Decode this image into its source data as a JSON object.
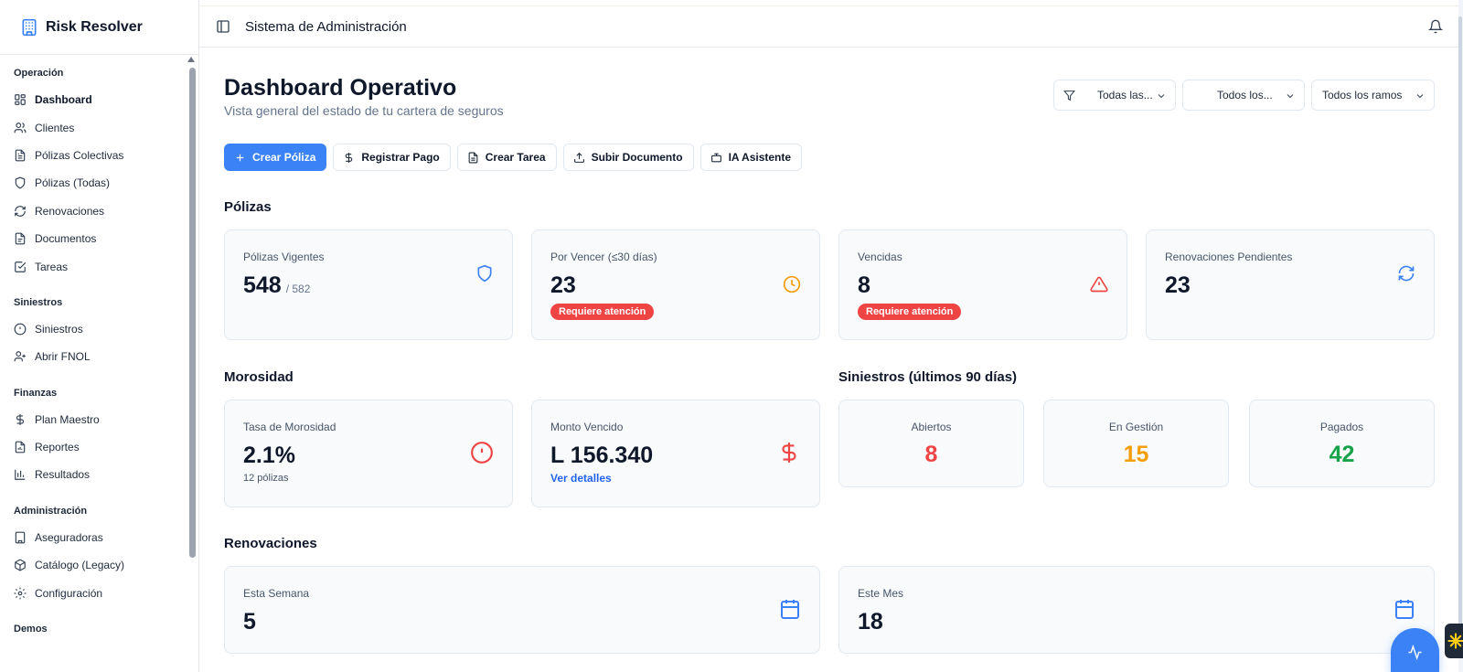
{
  "app": {
    "name": "Risk Resolver",
    "header_title": "Sistema de Administración"
  },
  "sidebar": {
    "sections": [
      {
        "title": "Operación",
        "items": [
          {
            "label": "Dashboard",
            "icon": "layout-dashboard-icon",
            "active": true
          },
          {
            "label": "Clientes",
            "icon": "users-icon"
          },
          {
            "label": "Pólizas Colectivas",
            "icon": "file-text-icon"
          },
          {
            "label": "Pólizas (Todas)",
            "icon": "shield-icon"
          },
          {
            "label": "Renovaciones",
            "icon": "refresh-icon"
          },
          {
            "label": "Documentos",
            "icon": "file-icon"
          },
          {
            "label": "Tareas",
            "icon": "check-square-icon"
          }
        ]
      },
      {
        "title": "Siniestros",
        "items": [
          {
            "label": "Siniestros",
            "icon": "alert-circle-icon"
          },
          {
            "label": "Abrir FNOL",
            "icon": "user-plus-icon"
          }
        ]
      },
      {
        "title": "Finanzas",
        "items": [
          {
            "label": "Plan Maestro",
            "icon": "dollar-icon"
          },
          {
            "label": "Reportes",
            "icon": "report-icon"
          },
          {
            "label": "Resultados",
            "icon": "bar-chart-icon"
          }
        ]
      },
      {
        "title": "Administración",
        "items": [
          {
            "label": "Aseguradoras",
            "icon": "building-icon"
          },
          {
            "label": "Catálogo (Legacy)",
            "icon": "package-icon"
          },
          {
            "label": "Configuración",
            "icon": "gear-icon"
          }
        ]
      },
      {
        "title": "Demos",
        "items": []
      }
    ]
  },
  "dashboard": {
    "title": "Dashboard Operativo",
    "subtitle": "Vista general del estado de tu cartera de seguros",
    "filters": [
      "Todas las...",
      "Todos los...",
      "Todos los ramos"
    ],
    "actions": [
      "Crear Póliza",
      "Registrar Pago",
      "Crear Tarea",
      "Subir Documento",
      "IA Asistente"
    ]
  },
  "polizas": {
    "title": "Pólizas",
    "vigentes": {
      "label": "Pólizas Vigentes",
      "value": "548",
      "total": "/ 582"
    },
    "por_vencer": {
      "label": "Por Vencer (≤30 días)",
      "value": "23",
      "badge": "Requiere atención"
    },
    "vencidas": {
      "label": "Vencidas",
      "value": "8",
      "badge": "Requiere atención"
    },
    "renovaciones": {
      "label": "Renovaciones Pendientes",
      "value": "23"
    }
  },
  "morosidad": {
    "title": "Morosidad",
    "tasa": {
      "label": "Tasa de Morosidad",
      "value": "2.1%",
      "sub": "12 pólizas"
    },
    "monto": {
      "label": "Monto Vencido",
      "value": "L 156.340",
      "link": "Ver detalles"
    }
  },
  "siniestros": {
    "title": "Siniestros (últimos 90 días)",
    "abiertos": {
      "label": "Abiertos",
      "value": "8"
    },
    "en_gestion": {
      "label": "En Gestión",
      "value": "15"
    },
    "pagados": {
      "label": "Pagados",
      "value": "42"
    }
  },
  "renovaciones": {
    "title": "Renovaciones",
    "semana": {
      "label": "Esta Semana",
      "value": "5"
    },
    "mes": {
      "label": "Este Mes",
      "value": "18"
    }
  },
  "colors": {
    "primary": "#3b82f6",
    "danger": "#ef4444",
    "warning": "#f59e0b",
    "success": "#16a34a"
  }
}
